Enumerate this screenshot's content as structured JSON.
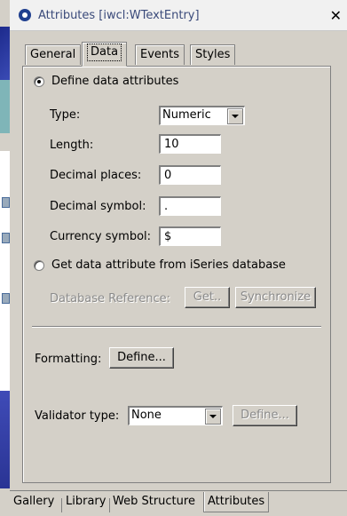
{
  "window": {
    "title": "Attributes [iwcl:WTextEntry]"
  },
  "tabs": [
    {
      "label": "General"
    },
    {
      "label": "Data",
      "active": true
    },
    {
      "label": "Events"
    },
    {
      "label": "Styles"
    }
  ],
  "data_tab": {
    "define_radio_label": "Define data attributes",
    "type_label": "Type:",
    "type_value": "Numeric",
    "length_label": "Length:",
    "length_value": "10",
    "decimal_places_label": "Decimal places:",
    "decimal_places_value": "0",
    "decimal_symbol_label": "Decimal symbol:",
    "decimal_symbol_value": ".",
    "currency_symbol_label": "Currency symbol:",
    "currency_symbol_value": "$",
    "iseries_radio_label": "Get data attribute from iSeries database",
    "db_reference_label": "Database Reference:",
    "get_button": "Get..",
    "synchronize_button": "Synchronize",
    "formatting_label": "Formatting:",
    "formatting_define_button": "Define...",
    "validator_label": "Validator type:",
    "validator_value": "None",
    "validator_define_button": "Define..."
  },
  "bottom_tabs": [
    {
      "label": "Gallery"
    },
    {
      "label": "Library"
    },
    {
      "label": "Web Structure"
    },
    {
      "label": "Attributes",
      "active": true
    }
  ]
}
